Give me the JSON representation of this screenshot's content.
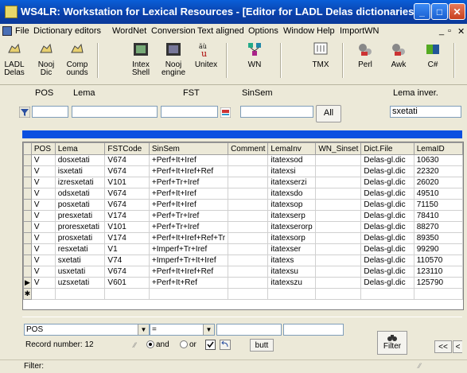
{
  "window": {
    "title": "WS4LR: Workstation for Lexical Resources - [Editor for LADL Delas dictionaries]"
  },
  "menu": [
    "File",
    "Dictionary editors",
    "WordNet",
    "Conversion",
    "Text aligned",
    "Options",
    "Window",
    "Help",
    "ImportWN"
  ],
  "toolbar": [
    {
      "l1": "LADL",
      "l2": "Delas"
    },
    {
      "l1": "Nooj",
      "l2": "Dic"
    },
    {
      "l1": "Comp",
      "l2": "ounds"
    },
    {
      "l1": "Intex",
      "l2": "Shell"
    },
    {
      "l1": "Nooj",
      "l2": "engine"
    },
    {
      "l1": "",
      "l2": "Unitex"
    },
    {
      "l1": "",
      "l2": "WN"
    },
    {
      "l1": "",
      "l2": "TMX"
    },
    {
      "l1": "",
      "l2": "Perl"
    },
    {
      "l1": "",
      "l2": "Awk"
    },
    {
      "l1": "",
      "l2": "C#"
    }
  ],
  "filters": {
    "pos_label": "POS",
    "lema_label": "Lema",
    "fst_label": "FST",
    "sinsem_label": "SinSem",
    "lema_inver_label": "Lema inver.",
    "lema_inver_value": "sxetati",
    "all_button": "All"
  },
  "table": {
    "columns": [
      "POS",
      "Lema",
      "FSTCode",
      "SinSem",
      "Comment",
      "LemaInv",
      "WN_Sinset",
      "Dict.File",
      "LemaID"
    ],
    "rows": [
      [
        "V",
        "dosxetati",
        "V674",
        "+Perf+It+Iref",
        "",
        "itatexsod",
        "",
        "Delas-gl.dic",
        "10630"
      ],
      [
        "V",
        "isxetati",
        "V674",
        "+Perf+It+Iref+Ref",
        "",
        "itatexsi",
        "",
        "Delas-gl.dic",
        "22320"
      ],
      [
        "V",
        "izresxetati",
        "V101",
        "+Perf+Tr+Iref",
        "",
        "itatexserzi",
        "",
        "Delas-gl.dic",
        "26020"
      ],
      [
        "V",
        "odsxetati",
        "V674",
        "+Perf+It+Iref",
        "",
        "itatexsdo",
        "",
        "Delas-gl.dic",
        "49510"
      ],
      [
        "V",
        "posxetati",
        "V674",
        "+Perf+It+Iref",
        "",
        "itatexsop",
        "",
        "Delas-gl.dic",
        "71150"
      ],
      [
        "V",
        "presxetati",
        "V174",
        "+Perf+Tr+Iref",
        "",
        "itatexserp",
        "",
        "Delas-gl.dic",
        "78410"
      ],
      [
        "V",
        "proresxetati",
        "V101",
        "+Perf+Tr+Iref",
        "",
        "itatexserorp",
        "",
        "Delas-gl.dic",
        "88270"
      ],
      [
        "V",
        "prosxetati",
        "V174",
        "+Perf+It+Iref+Ref+Tr",
        "",
        "itatexsorp",
        "",
        "Delas-gl.dic",
        "89350"
      ],
      [
        "V",
        "resxetati",
        "V1",
        "+Imperf+Tr+Iref",
        "",
        "itatexser",
        "",
        "Delas-gl.dic",
        "99290"
      ],
      [
        "V",
        "sxetati",
        "V74",
        "+Imperf+Tr+It+Iref",
        "",
        "itatexs",
        "",
        "Delas-gl.dic",
        "110570"
      ],
      [
        "V",
        "usxetati",
        "V674",
        "+Perf+It+Iref+Ref",
        "",
        "itatexsu",
        "",
        "Delas-gl.dic",
        "123110"
      ],
      [
        "V",
        "uzsxetati",
        "V601",
        "+Perf+It+Ref",
        "",
        "itatexszu",
        "",
        "Delas-gl.dic",
        "125790"
      ]
    ]
  },
  "bottom": {
    "field_select": "POS",
    "operator_select": "=",
    "record_label": "Record number: 12",
    "and_label": "and",
    "or_label": "or",
    "butt_label": "butt",
    "filter_button": "Filter",
    "nav_prev": "<<",
    "nav_prev2": "<"
  },
  "status": {
    "filter_label": "Filter:"
  }
}
